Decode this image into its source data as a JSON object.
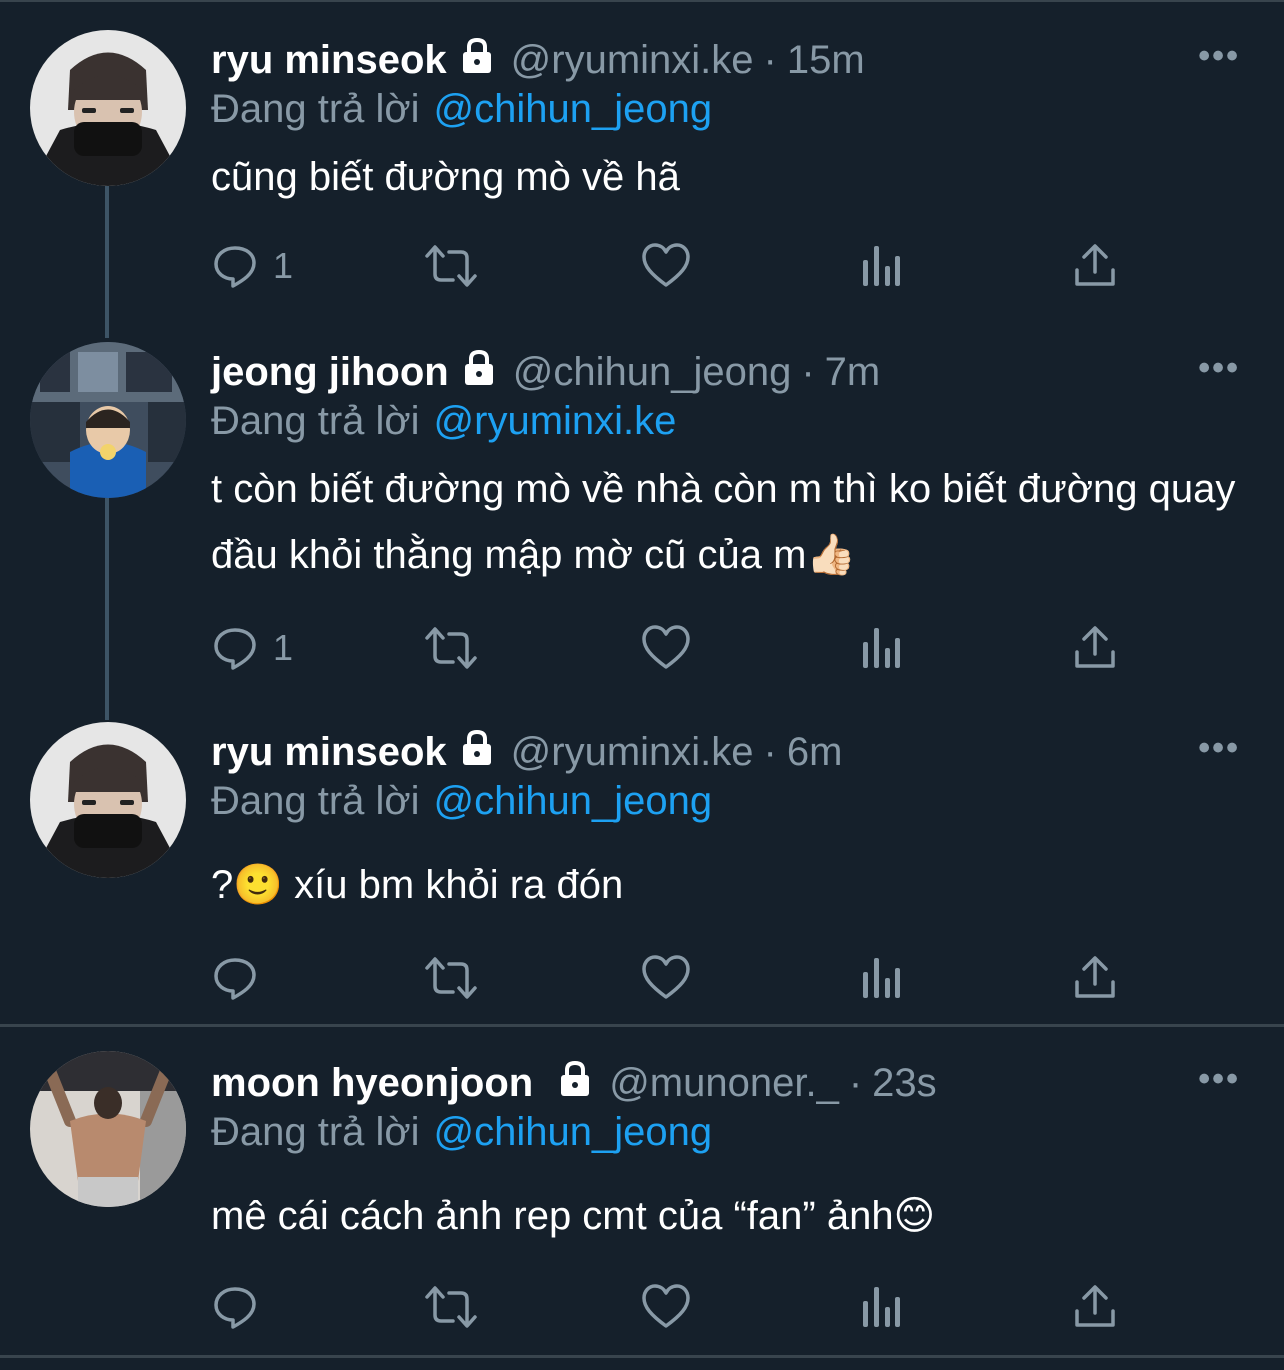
{
  "tweets": [
    {
      "name": "ryu minseok",
      "handle": "@ryuminxi.ke",
      "time": "15m",
      "replying_label": "Đang trả lời",
      "replying_to": "@chihun_jeong",
      "text": "cũng biết đường mò về hã",
      "reply_count": "1",
      "retweet_count": "",
      "like_count": ""
    },
    {
      "name": "jeong jihoon",
      "handle": "@chihun_jeong",
      "time": "7m",
      "replying_label": "Đang trả lời",
      "replying_to": "@ryuminxi.ke",
      "text": "t còn biết đường mò về nhà còn m thì ko biết đường quay đầu khỏi thằng mập mờ cũ của m👍🏻",
      "reply_count": "1",
      "retweet_count": "",
      "like_count": ""
    },
    {
      "name": "ryu minseok",
      "handle": "@ryuminxi.ke",
      "time": "6m",
      "replying_label": "Đang trả lời",
      "replying_to": "@chihun_jeong",
      "text": "?🙂 xíu bm khỏi ra đón",
      "reply_count": "",
      "retweet_count": "",
      "like_count": ""
    },
    {
      "name": "moon hyeonjoon",
      "handle": "@munoner._",
      "time": "23s",
      "replying_label": "Đang trả lời",
      "replying_to": "@chihun_jeong",
      "text": "mê cái cách ảnh rep cmt của “fan” ảnh😊",
      "reply_count": "",
      "retweet_count": "",
      "like_count": ""
    }
  ],
  "ui": {
    "separator": "·",
    "more_glyph": "•••"
  },
  "icons": {
    "reply": "reply-icon",
    "retweet": "retweet-icon",
    "like": "heart-icon",
    "analytics": "analytics-icon",
    "share": "share-icon",
    "lock": "lock-icon",
    "more": "more-icon"
  },
  "colors": {
    "background": "#15202b",
    "secondary_text": "#8899a6",
    "link": "#1da1f2",
    "divider": "#38444d",
    "thread_line": "#3d5466"
  }
}
